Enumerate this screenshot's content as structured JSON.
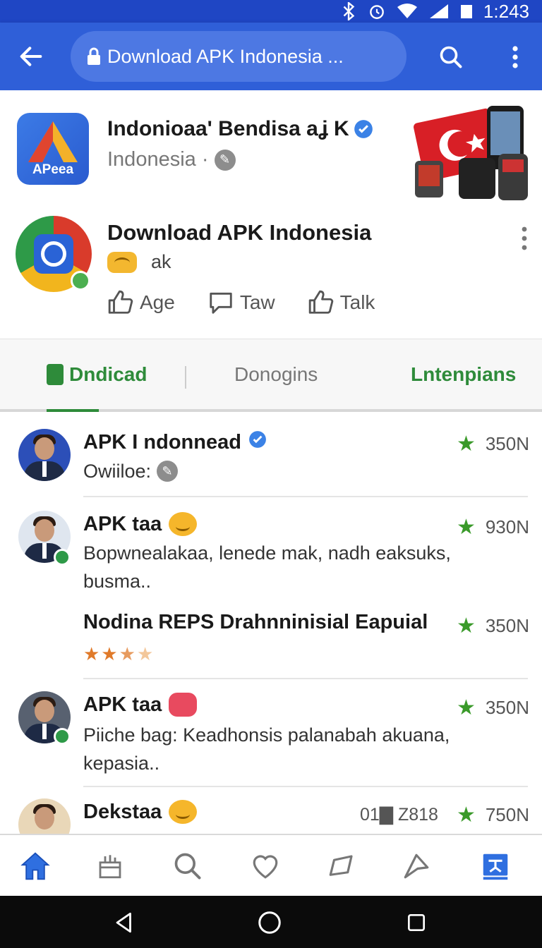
{
  "status_bar": {
    "time": "1:243"
  },
  "app_bar": {
    "url": "Download APK Indonesia ..."
  },
  "publisher": {
    "title": "Indonioaa' Bendisa aʝ K",
    "subtitle": "Indonesia ·",
    "icon_label": "APeea"
  },
  "app": {
    "title": "Download APK Indonesia",
    "subtitle": "ak",
    "actions": [
      "Age",
      "Taw",
      "Talk"
    ]
  },
  "tabs": [
    "Dndicad",
    "Donogins",
    "Lntenpians"
  ],
  "list": [
    {
      "name": "APK I ndonnead",
      "text": "Owiiloe:",
      "rating": "350N"
    },
    {
      "name": "APK taa",
      "text": "Bopwnealakaa, lenede mak, nadh eaksuks, busma..",
      "rating": "930N"
    },
    {
      "name": "Nodina REPS Drahnninisial Eapuial",
      "rating": "350N",
      "stars": 3.5
    },
    {
      "name": "APK taa",
      "text": "Piiche bag: Keadhonsis palanabah akuana, kepasia..",
      "rating": "350N"
    },
    {
      "name": "Dekstaa",
      "meta": "01▇ Z818",
      "rating": "750N"
    }
  ],
  "icons": {
    "bottom_nav": [
      "home-icon",
      "store-icon",
      "search-icon",
      "heart-icon",
      "chat-icon",
      "send-icon",
      "profile-icon"
    ],
    "system_nav": [
      "back-icon",
      "home-circle-icon",
      "recents-icon"
    ]
  },
  "colors": {
    "app_bar": "#2f5fd8",
    "accent_green": "#2e8b3a",
    "nav_active": "#2f6fe0"
  }
}
